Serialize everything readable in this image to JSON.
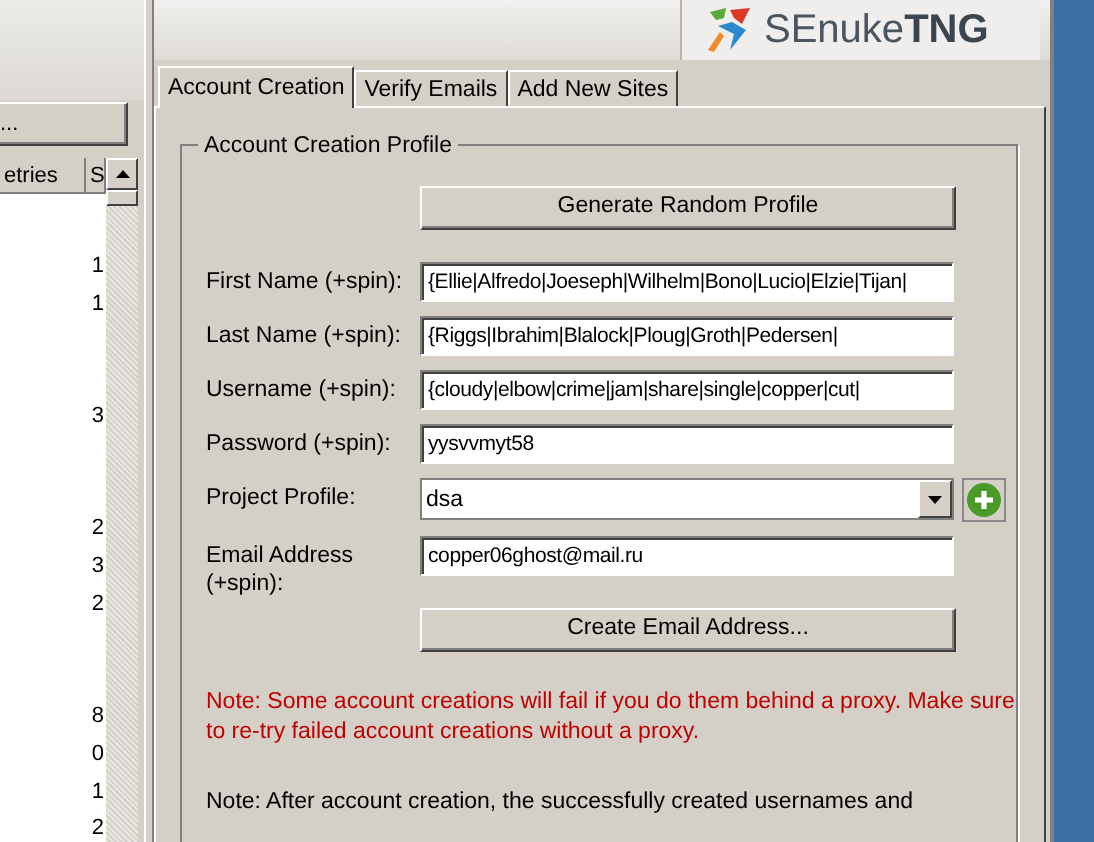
{
  "left_panel": {
    "button": "...",
    "columns": [
      "etries",
      "S"
    ],
    "rows": [
      {
        "value": "1"
      },
      {
        "value": "1"
      },
      {},
      {},
      {
        "value": "3"
      },
      {},
      {},
      {
        "value": "2"
      },
      {
        "value": "3"
      },
      {
        "value": "2"
      },
      {},
      {},
      {
        "value": "8"
      },
      {
        "value": "0"
      },
      {
        "value": "1"
      },
      {
        "value": "2"
      }
    ]
  },
  "logo": {
    "text": "SEnuke**TNG**"
  },
  "tabs": [
    {
      "label": "Account Creation",
      "selected": true
    },
    {
      "label": "Verify Emails",
      "selected": false
    },
    {
      "label": "Add New Sites",
      "selected": false
    }
  ],
  "group": {
    "title": "Account Creation Profile",
    "generate_button": "Generate Random Profile",
    "fields": [
      {
        "kind": "text",
        "label": "First Name (+spin):",
        "value": "{Ellie|Alfredo|Joeseph|Wilhelm|Bono|Lucio|Elzie|Tijan|"
      },
      {
        "kind": "text",
        "label": "Last Name (+spin):",
        "value": "{Riggs|Ibrahim|Blalock|Ploug|Groth|Pedersen|"
      },
      {
        "kind": "text",
        "label": "Username (+spin):",
        "value": "{cloudy|elbow|crime|jam|share|single|copper|cut|"
      },
      {
        "kind": "text",
        "label": "Password (+spin):",
        "value": "yysvvmyt58"
      },
      {
        "kind": "combo",
        "label": "Project Profile:",
        "value": "dsa"
      },
      {
        "kind": "text",
        "label": "Email Address (+spin):",
        "value": "copper06ghost@mail.ru"
      }
    ],
    "create_button": "Create Email Address...",
    "notes": [
      {
        "kind": "warning",
        "text": "Note: Some account creations will fail if you do them behind a proxy. Make sure to re-try failed account creations without a proxy."
      },
      {
        "kind": "info",
        "text": "Note: After account creation, the successfully created usernames and"
      }
    ]
  }
}
